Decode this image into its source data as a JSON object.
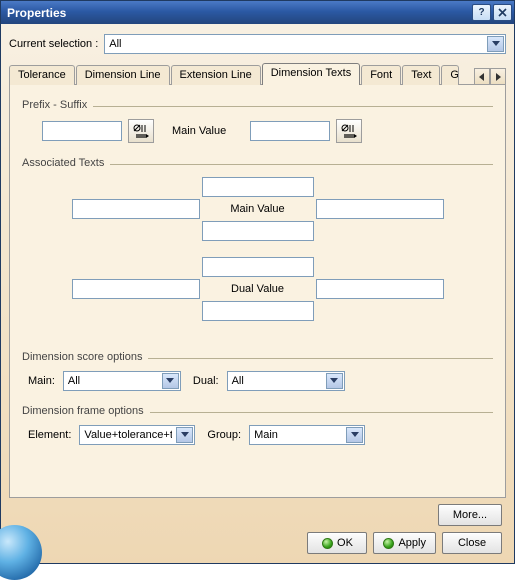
{
  "title": "Properties",
  "current_selection_label": "Current selection :",
  "current_selection_value": "All",
  "tabs": {
    "tolerance": "Tolerance",
    "dimension_line": "Dimension Line",
    "extension_line": "Extension Line",
    "dimension_texts": "Dimension Texts",
    "font": "Font",
    "text": "Text",
    "graphic": "Graphic"
  },
  "groups": {
    "prefix_suffix": "Prefix - Suffix",
    "associated_texts": "Associated Texts",
    "score": "Dimension score options",
    "frame": "Dimension frame options"
  },
  "prefix": {
    "main_value_label": "Main Value",
    "prefix_value": "",
    "suffix_value": ""
  },
  "assoc": {
    "main_label": "Main Value",
    "dual_label": "Dual Value",
    "main": {
      "top": "",
      "left": "",
      "right": "",
      "bottom": ""
    },
    "dual": {
      "top": "",
      "left": "",
      "right": "",
      "bottom": ""
    }
  },
  "score": {
    "main_label": "Main:",
    "main_value": "All",
    "dual_label": "Dual:",
    "dual_value": "All"
  },
  "frame": {
    "element_label": "Element:",
    "element_value": "Value+tolerance+te",
    "group_label": "Group:",
    "group_value": "Main"
  },
  "buttons": {
    "more": "More...",
    "ok": "OK",
    "apply": "Apply",
    "close": "Close"
  }
}
